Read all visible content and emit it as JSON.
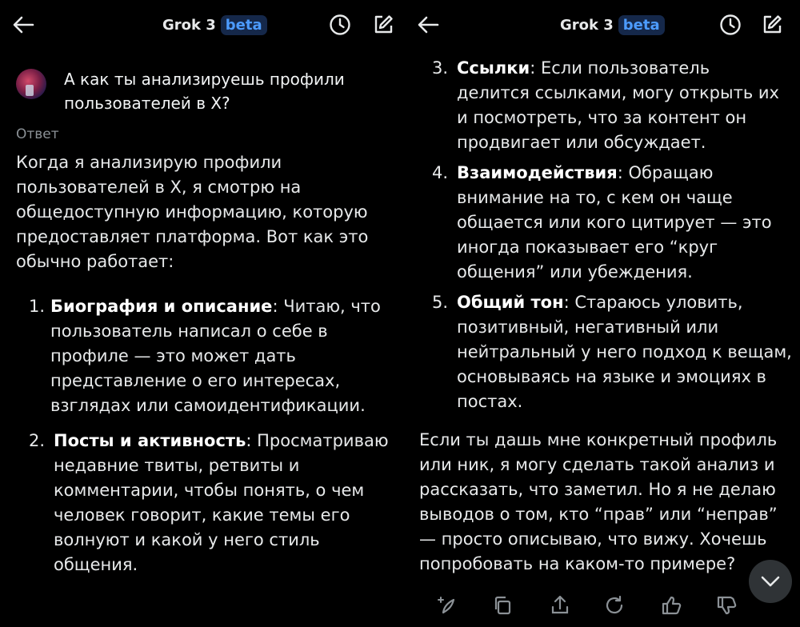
{
  "left": {
    "header": {
      "title": "Grok 3",
      "badge": "beta"
    },
    "question": "А как ты анализируешь профили пользователей в X?",
    "answer_label": "Ответ",
    "intro": "Когда я анализирую профили пользователей в X, я смотрю на общедоступную информацию, которую предоставляет платформа. Вот как это обычно работает:",
    "items": [
      {
        "num": "1.",
        "title": "Биография и описание",
        "text": ": Читаю, что пользователь написал о себе в профиле — это может дать представление о его интересах, взглядах или самоидентификации."
      },
      {
        "num": "2.",
        "title": "Посты и активность",
        "text": ": Просматриваю недавние твиты, ретвиты и комментарии, чтобы понять, о чем человек говорит, какие темы его волнуют и какой у него стиль общения."
      }
    ]
  },
  "right": {
    "header": {
      "title": "Grok 3",
      "badge": "beta"
    },
    "items": [
      {
        "num": "3.",
        "title": "Ссылки",
        "text": ": Если пользователь делится ссылками, могу открыть их и посмотреть, что за контент он продвигает или обсуждает."
      },
      {
        "num": "4.",
        "title": "Взаимодействия",
        "text": ": Обращаю внимание на то, с кем он чаще общается или кого цитирует — это иногда показывает его “круг общения” или убеждения."
      },
      {
        "num": "5.",
        "title": "Общий тон",
        "text": ": Стараюсь уловить, позитивный, негативный или нейтральный у него подход к вещам, основываясь на языке и эмоциях в постах."
      }
    ],
    "outro": "Если ты дашь мне конкретный профиль или ник, я могу сделать такой анализ и рассказать, что заметил. Но я не делаю выводов о том, кто “прав” или “неправ” — просто описываю, что вижу. Хочешь попробовать на каком-то примере?"
  },
  "icons": {
    "back": "back-arrow-icon",
    "history": "clock-icon",
    "new_chat": "edit-icon",
    "scroll_down": "chevron-down-icon",
    "actions": [
      "regenerate-sparkle-icon",
      "copy-icon",
      "share-icon",
      "refresh-icon",
      "thumbs-up-icon",
      "thumbs-down-icon"
    ]
  },
  "colors": {
    "background": "#000000",
    "text": "#e7e9ea",
    "muted": "#8b9196",
    "beta_bg": "#15284a",
    "beta_text": "#4c9bff"
  }
}
